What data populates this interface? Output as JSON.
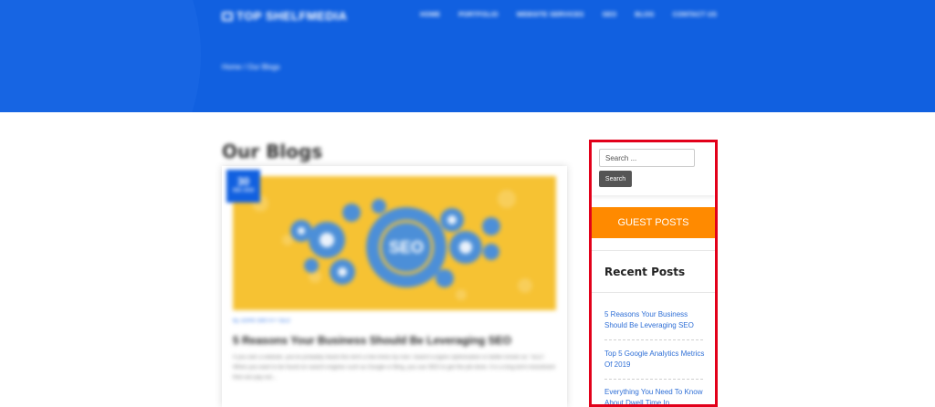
{
  "header": {
    "logo_text": "TOP SHELFMEDIA",
    "nav": [
      "HOME",
      "PORTFOLIO",
      "WEBSITE SERVICES",
      "SEO",
      "BLOG",
      "CONTACT US"
    ],
    "breadcrumb": "Home / Our Blogs",
    "accent_color": "#1160e0"
  },
  "main": {
    "heading": "Our Blogs",
    "post": {
      "date_day": "30",
      "date_month": "DEC 2019",
      "image_text": "SEO",
      "meta": "by JOHN SMITH • SEO",
      "title": "5 Reasons Your Business Should Be Leveraging SEO",
      "excerpt": "If you own a website, you've probably heard this term a few times by now: Search Engine Optimization or better known as \"SEO\". When you want to be found on search engines such as Google or Bing, you use SEO to get the job done. It is a long term investment that can pay out..."
    }
  },
  "sidebar": {
    "search_placeholder": "Search ...",
    "search_button": "Search",
    "guest_posts": "GUEST POSTS",
    "guest_posts_color": "#ff8a00",
    "recent_title": "Recent Posts",
    "recent_posts": [
      "5 Reasons Your Business Should Be Leveraging SEO",
      "Top 5 Google Analytics Metrics Of 2019",
      "Everything You Need To Know About Dwell Time In"
    ],
    "highlight_color": "#e2001a"
  }
}
